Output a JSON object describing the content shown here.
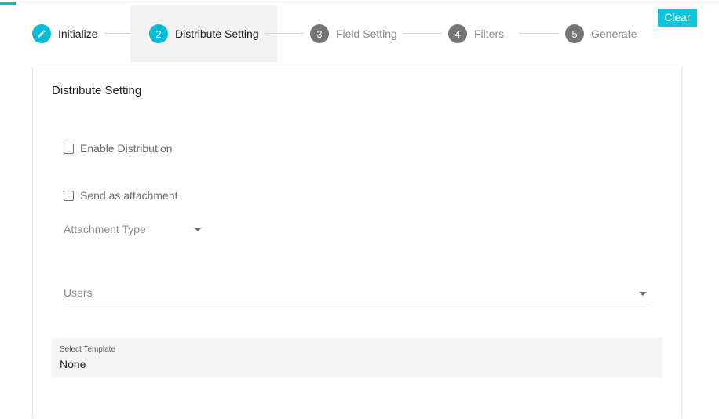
{
  "toolbar": {
    "clear_label": "Clear"
  },
  "stepper": {
    "steps": [
      {
        "number": "",
        "label": "Initialize",
        "state": "done",
        "icon": "pencil-icon"
      },
      {
        "number": "2",
        "label": "Distribute Setting",
        "state": "active"
      },
      {
        "number": "3",
        "label": "Field Setting",
        "state": "pending"
      },
      {
        "number": "4",
        "label": "Filters",
        "state": "pending"
      },
      {
        "number": "5",
        "label": "Generate",
        "state": "pending"
      }
    ]
  },
  "card": {
    "title": "Distribute Setting",
    "enable_distribution": {
      "label": "Enable Distribution",
      "checked": false
    },
    "send_as_attachment": {
      "label": "Send as attachment",
      "checked": false
    },
    "attachment_type": {
      "placeholder": "Attachment Type"
    },
    "users": {
      "placeholder": "Users"
    },
    "select_template": {
      "caption": "Select Template",
      "value": "None"
    }
  },
  "colors": {
    "accent": "#00bcd4",
    "clear_button": "#0fc4dd",
    "pending_step": "#757575",
    "active_step_bg": "#f2f2f2"
  }
}
